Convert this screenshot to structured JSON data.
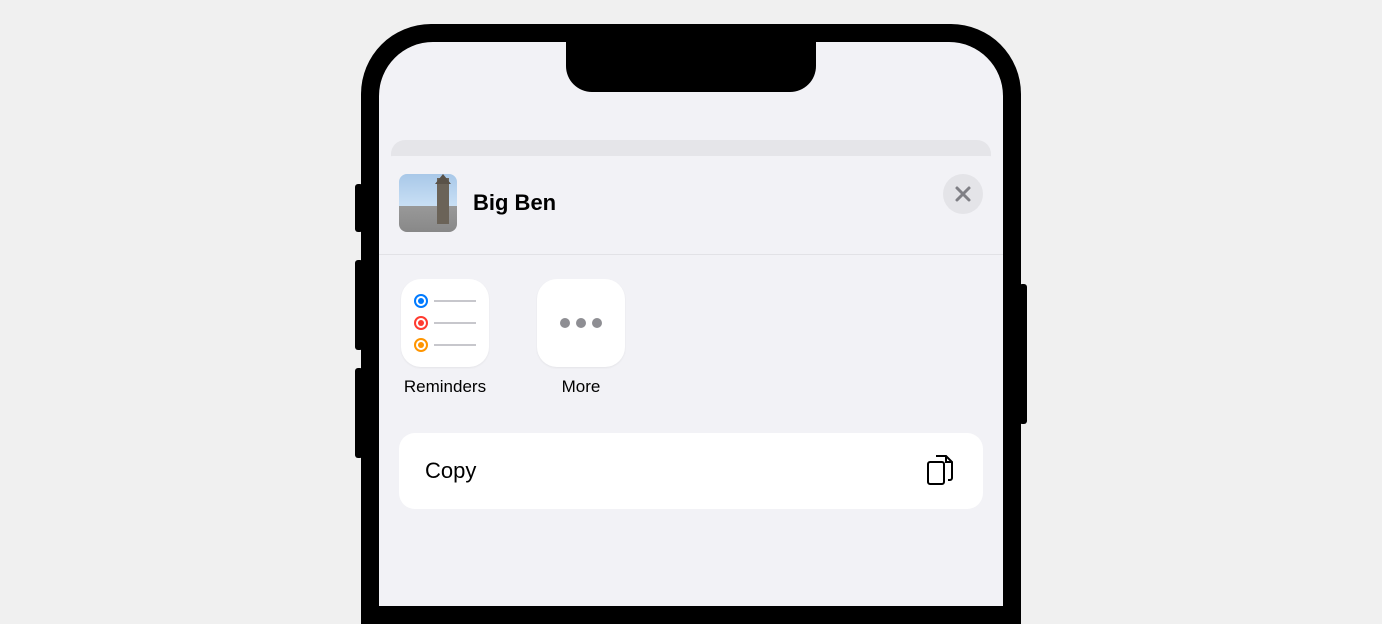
{
  "share": {
    "title": "Big Ben",
    "thumbnail_alt": "Big Ben photo",
    "apps": [
      {
        "name": "reminders",
        "label": "Reminders"
      },
      {
        "name": "more",
        "label": "More"
      }
    ],
    "actions": [
      {
        "name": "copy",
        "label": "Copy",
        "icon": "copy-doc-icon"
      }
    ]
  }
}
